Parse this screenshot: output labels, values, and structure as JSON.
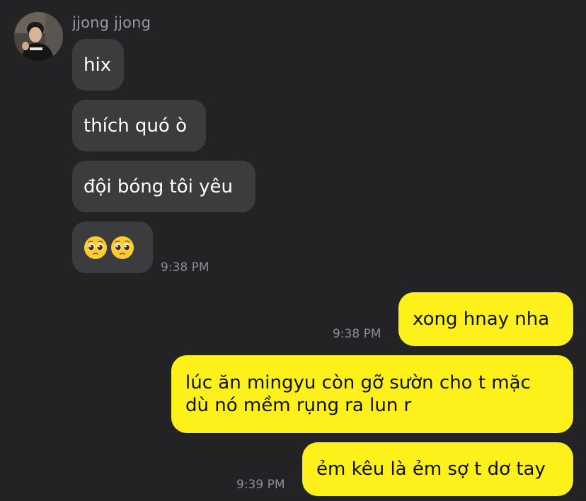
{
  "contact": {
    "name": "jjong jjong",
    "avatar_icon": "profile-photo-avatar"
  },
  "incoming": [
    {
      "text": "hix"
    },
    {
      "text": "thích quó ò"
    },
    {
      "text": "đội bóng tôi yêu"
    },
    {
      "emoji": "pleading-face-emoji",
      "emoji_count": 2,
      "time": "9:38 PM"
    }
  ],
  "outgoing": [
    {
      "text": "xong hnay nha",
      "time": "9:38 PM"
    },
    {
      "text": "lúc ăn mingyu còn gỡ sườn cho t mặc dù nó mềm rụng ra lun r"
    },
    {
      "text": "ẻm kêu là ẻm sợ t dơ tay",
      "time": "9:39 PM"
    }
  ],
  "colors": {
    "background": "#232325",
    "incoming_bubble": "#3c3c3e",
    "outgoing_bubble": "#fef01b",
    "timestamp": "#8e8e93",
    "sender_name": "#9a9aa0"
  }
}
